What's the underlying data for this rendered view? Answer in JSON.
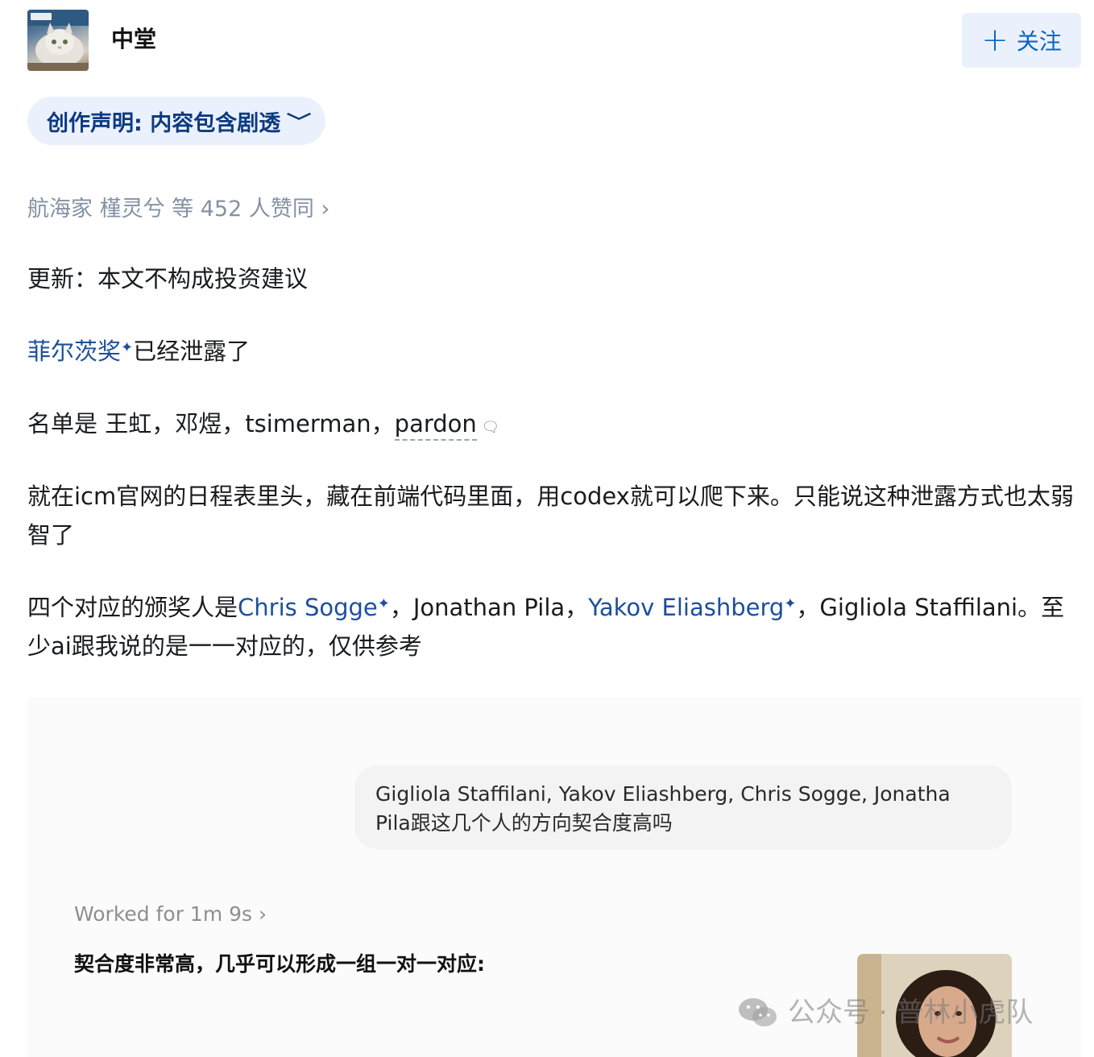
{
  "header": {
    "author_name": "中堂",
    "follow_button": {
      "icon": "plus-icon",
      "label": "关注"
    }
  },
  "statement": {
    "label": "创作声明: 内容包含剧透",
    "icon": "chevron-down-icon"
  },
  "likes_text": "航海家 槿灵兮 等 452 人赞同",
  "likes_chevron": "›",
  "content": {
    "p1": "更新：本文不构成投资建议",
    "p2_link": "菲尔茨奖",
    "p2_rest": "已经泄露了",
    "p3_pre": "名单是 王虹，邓煜，tsimerman，",
    "p3_underlined": "pardon",
    "p4": "就在icm官网的日程表里头，藏在前端代码里面，用codex就可以爬下来。只能说这种泄露方式也太弱智了",
    "p5_a": "四个对应的颁奖人是",
    "p5_link1": "Chris Sogge",
    "p5_b": "，Jonathan Pila，",
    "p5_link2": "Yakov Eliashberg",
    "p5_c": "，Gigliola Staffilani。至少ai跟我说的是一一对应的，仅供参考",
    "spark": "✦"
  },
  "screenshot": {
    "user_message": "Gigliola Staffilani, Yakov Eliashberg, Chris Sogge, Jonatha Pila跟这几个人的方向契合度高吗",
    "worked_for": "Worked for 1m 9s ›",
    "answer_heading": "契合度非常高，几乎可以形成一组一对一对应:"
  },
  "watermark": {
    "icon": "wechat-icon",
    "text": "公众号 · 普林小虎队"
  },
  "colors": {
    "accent": "#0a66c2",
    "link": "#1c4f9c",
    "muted": "#8491a5",
    "pill_bg": "#ebf1fc"
  }
}
